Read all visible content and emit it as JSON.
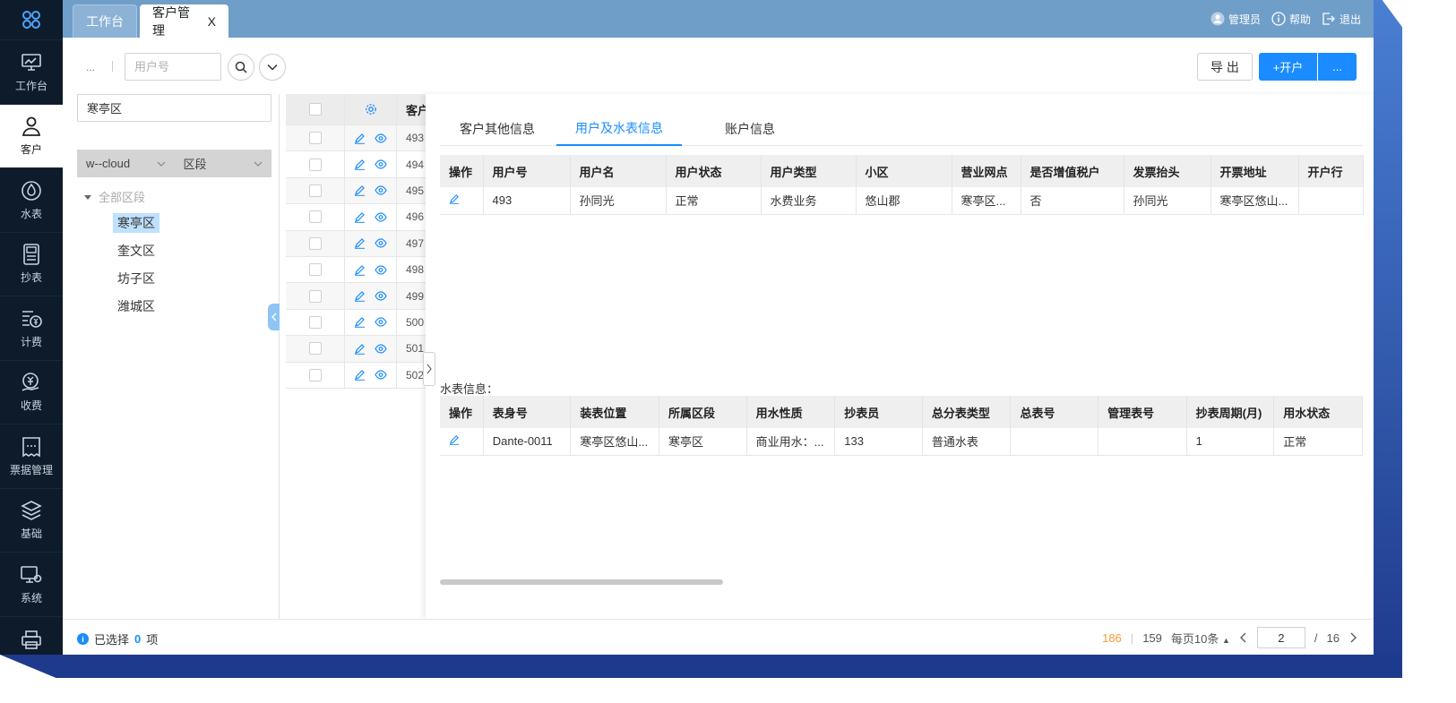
{
  "sidebar": {
    "items": [
      {
        "label": "工作台",
        "icon": "monitor-icon",
        "active": false
      },
      {
        "label": "客户",
        "icon": "user-icon",
        "active": true
      },
      {
        "label": "水表",
        "icon": "meter-icon",
        "active": false
      },
      {
        "label": "抄表",
        "icon": "reading-icon",
        "active": false
      },
      {
        "label": "计费",
        "icon": "billing-icon",
        "active": false
      },
      {
        "label": "收费",
        "icon": "payment-icon",
        "active": false
      },
      {
        "label": "票据管理",
        "icon": "invoice-icon",
        "active": false
      },
      {
        "label": "基础",
        "icon": "layers-icon",
        "active": false
      },
      {
        "label": "系统",
        "icon": "settings-monitor-icon",
        "active": false
      },
      {
        "label": "",
        "icon": "printer-icon",
        "active": false
      }
    ]
  },
  "tabs": {
    "home": "工作台",
    "customers": "客户管理",
    "close": "X"
  },
  "header": {
    "admin": "管理员",
    "help": "帮助",
    "logout": "退出"
  },
  "toolbar": {
    "more_left": "...",
    "search_placeholder": "用户号",
    "export": "导 出",
    "open_account": "+开户",
    "more": "..."
  },
  "tree": {
    "search_value": "寒亭区",
    "filter_company": "w--cloud",
    "filter_segment": "区段",
    "root": "全部区段",
    "nodes": [
      "寒亭区",
      "奎文区",
      "坊子区",
      "潍城区"
    ],
    "selected_index": 0
  },
  "main_table": {
    "header": "客户",
    "ids": [
      "493",
      "494",
      "495",
      "496",
      "497",
      "498",
      "499",
      "500",
      "501",
      "502"
    ]
  },
  "drawer": {
    "tabs": [
      "客户其他信息",
      "用户及水表信息",
      "账户信息"
    ],
    "active_tab": 1,
    "user_columns": [
      "操作",
      "用户号",
      "用户名",
      "用户状态",
      "用户类型",
      "小区",
      "营业网点",
      "是否增值税户",
      "发票抬头",
      "开票地址",
      "开户行"
    ],
    "user_rows": [
      [
        "",
        "493",
        "孙同光",
        "正常",
        "水费业务",
        "悠山郡",
        "寒亭区...",
        "否",
        "孙同光",
        "寒亭区悠山...",
        ""
      ]
    ],
    "meter_label": "水表信息：",
    "meter_columns": [
      "操作",
      "表身号",
      "装表位置",
      "所属区段",
      "用水性质",
      "抄表员",
      "总分表类型",
      "总表号",
      "管理表号",
      "抄表周期(月)",
      "用水状态"
    ],
    "meter_rows": [
      [
        "",
        "Dante-0011",
        "寒亭区悠山...",
        "寒亭区",
        "商业用水：...",
        "133",
        "普通水表",
        "",
        "",
        "1",
        "正常"
      ]
    ]
  },
  "footer": {
    "selected_prefix": "已选择",
    "selected_count": "0",
    "selected_suffix": "项",
    "total_a": "186",
    "total_b": "159",
    "page_size": "每页10条",
    "current_page": "2",
    "total_pages": "16"
  }
}
